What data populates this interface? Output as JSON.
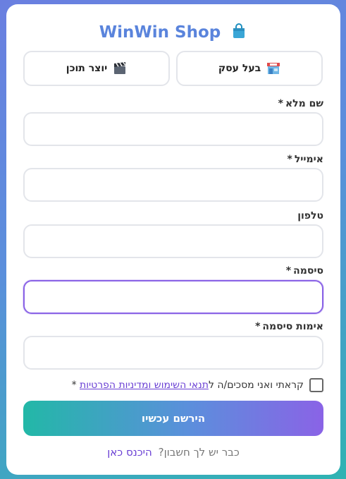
{
  "brand": {
    "name": "WinWin Shop",
    "icon": "shopping-bag-icon",
    "color": "#5a84dc"
  },
  "roles": [
    {
      "label": "בעל עסק",
      "icon": "store-icon"
    },
    {
      "label": "יוצר תוכן",
      "icon": "clapperboard-icon"
    }
  ],
  "fields": {
    "full_name": {
      "label": "שם מלא",
      "required_mark": "*",
      "value": ""
    },
    "email": {
      "label": "אימייל",
      "required_mark": "*",
      "value": ""
    },
    "phone": {
      "label": "טלפון",
      "value": ""
    },
    "password": {
      "label": "סיסמה",
      "required_mark": "*",
      "value": ""
    },
    "confirm_password": {
      "label": "אימות סיסמה",
      "required_mark": "*",
      "value": ""
    }
  },
  "terms": {
    "prefix": "קראתי ואני מסכים/ה ל",
    "link": "תנאי השימוש ומדיניות הפרטיות",
    "required_mark": "*"
  },
  "submit_label": "הירשם עכשיו",
  "login": {
    "question": "כבר יש לך חשבון?",
    "link": "היכנס כאן"
  },
  "colors": {
    "accent": "#8a63e6",
    "teal": "#22b8a7",
    "link": "#6a40d4"
  }
}
